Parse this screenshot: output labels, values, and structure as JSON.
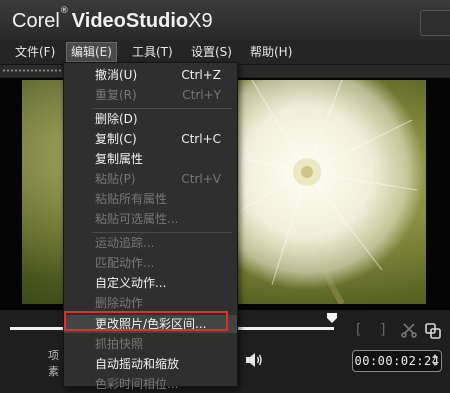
{
  "app": {
    "brand": "Corel",
    "brand_reg": "®",
    "product": "VideoStudio",
    "version": "X9"
  },
  "menubar": [
    {
      "label": "文件(F)"
    },
    {
      "label": "编辑(E)"
    },
    {
      "label": "工具(T)"
    },
    {
      "label": "设置(S)"
    },
    {
      "label": "帮助(H)"
    }
  ],
  "edit_menu": {
    "items": [
      {
        "label": "撤消(U)",
        "shortcut": "Ctrl+Z"
      },
      {
        "label": "重复(R)",
        "shortcut": "Ctrl+Y"
      },
      {
        "label": "删除(D)",
        "shortcut": ""
      },
      {
        "label": "复制(C)",
        "shortcut": "Ctrl+C"
      },
      {
        "label": "复制属性",
        "shortcut": ""
      },
      {
        "label": "粘贴(P)",
        "shortcut": "Ctrl+V"
      },
      {
        "label": "粘贴所有属性",
        "shortcut": ""
      },
      {
        "label": "粘贴可选属性...",
        "shortcut": ""
      },
      {
        "label": "运动追踪...",
        "shortcut": ""
      },
      {
        "label": "匹配动作...",
        "shortcut": ""
      },
      {
        "label": "自定义动作...",
        "shortcut": ""
      },
      {
        "label": "删除动作",
        "shortcut": ""
      },
      {
        "label": "更改照片/色彩区间...",
        "shortcut": ""
      },
      {
        "label": "抓拍快照",
        "shortcut": ""
      },
      {
        "label": "自动摇动和缩放",
        "shortcut": ""
      },
      {
        "label": "色彩时间相位...",
        "shortcut": ""
      }
    ]
  },
  "player": {
    "side_label_1": "项",
    "side_label_2": "素",
    "timecode": "00:00:02:24",
    "mark_in": "[",
    "mark_out": "]"
  },
  "colors": {
    "accent_highlight": "#e0302b",
    "menu_bg": "#2f2f2f",
    "enabled_text": "#f2f2f2",
    "disabled_text": "#777777"
  },
  "icons": [
    "scissors-icon",
    "copy-clip-icon",
    "volume-icon",
    "timecode-stepper-icon",
    "playhead-icon"
  ]
}
